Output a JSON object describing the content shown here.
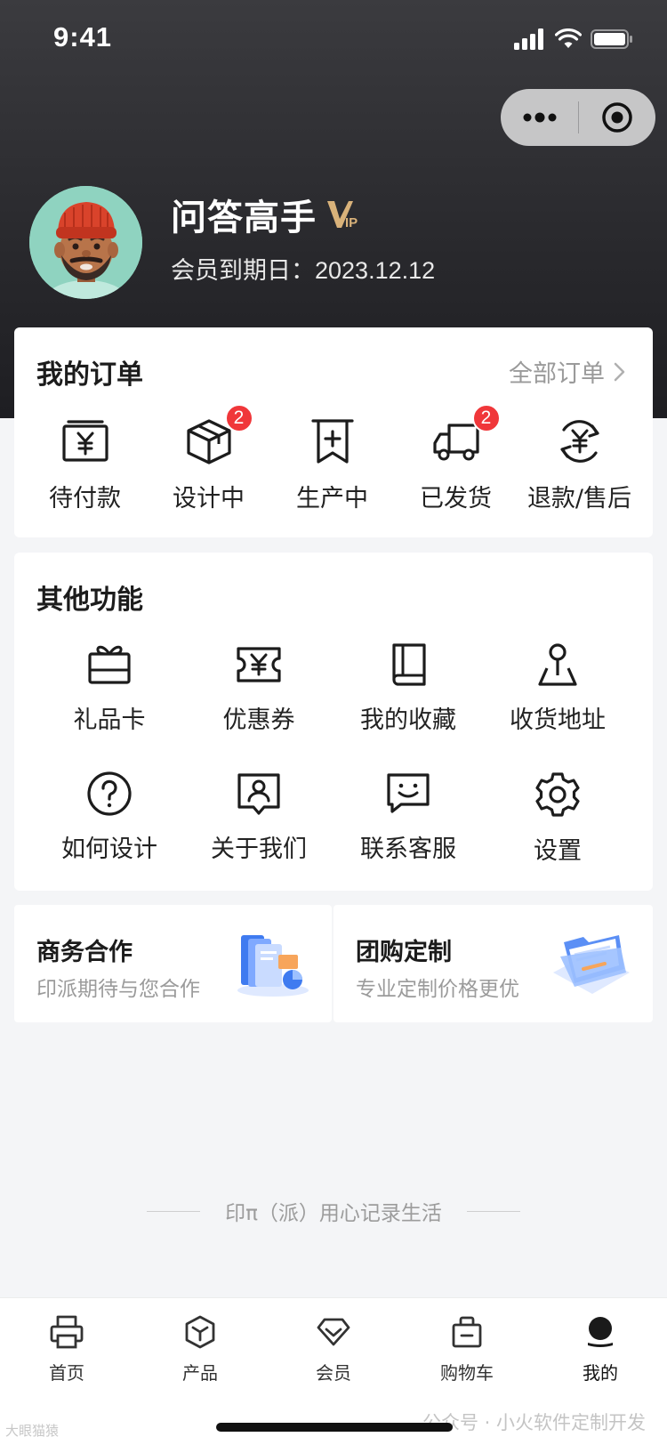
{
  "status_bar": {
    "time": "9:41"
  },
  "profile": {
    "name": "问答高手",
    "vip_label": "VIP",
    "expiry": "会员到期日：2023.12.12"
  },
  "orders": {
    "title": "我的订单",
    "all_label": "全部订单",
    "items": [
      {
        "label": "待付款",
        "icon": "wallet-yen-icon",
        "badge": ""
      },
      {
        "label": "设计中",
        "icon": "box-icon",
        "badge": "2"
      },
      {
        "label": "生产中",
        "icon": "receipt-plus-icon",
        "badge": ""
      },
      {
        "label": "已发货",
        "icon": "truck-icon",
        "badge": "2"
      },
      {
        "label": "退款/售后",
        "icon": "refund-yen-icon",
        "badge": ""
      }
    ]
  },
  "other_functions": {
    "title": "其他功能",
    "items": [
      {
        "label": "礼品卡",
        "icon": "gift-card-icon"
      },
      {
        "label": "优惠券",
        "icon": "coupon-icon"
      },
      {
        "label": "我的收藏",
        "icon": "book-icon"
      },
      {
        "label": "收货地址",
        "icon": "location-pin-icon"
      },
      {
        "label": "如何设计",
        "icon": "help-circle-icon"
      },
      {
        "label": "关于我们",
        "icon": "profile-card-icon"
      },
      {
        "label": "联系客服",
        "icon": "chat-smile-icon"
      },
      {
        "label": "设置",
        "icon": "gear-icon"
      }
    ]
  },
  "promos": [
    {
      "title": "商务合作",
      "subtitle": "印派期待与您合作"
    },
    {
      "title": "团购定制",
      "subtitle": "专业定制价格更优"
    }
  ],
  "slogan": "印π（派）用心记录生活",
  "tabbar": {
    "items": [
      {
        "label": "首页",
        "icon": "printer-icon"
      },
      {
        "label": "产品",
        "icon": "cube-icon"
      },
      {
        "label": "会员",
        "icon": "diamond-icon"
      },
      {
        "label": "购物车",
        "icon": "basket-icon"
      },
      {
        "label": "我的",
        "icon": "user-icon"
      }
    ],
    "active_index": 4
  },
  "watermarks": {
    "left": "大眼猫猿",
    "right": "公众号 · 小火软件定制开发"
  },
  "colors": {
    "header_dark": "#2a2a2e",
    "badge_red": "#f0373a",
    "vip_gold": "#d9b27a"
  }
}
